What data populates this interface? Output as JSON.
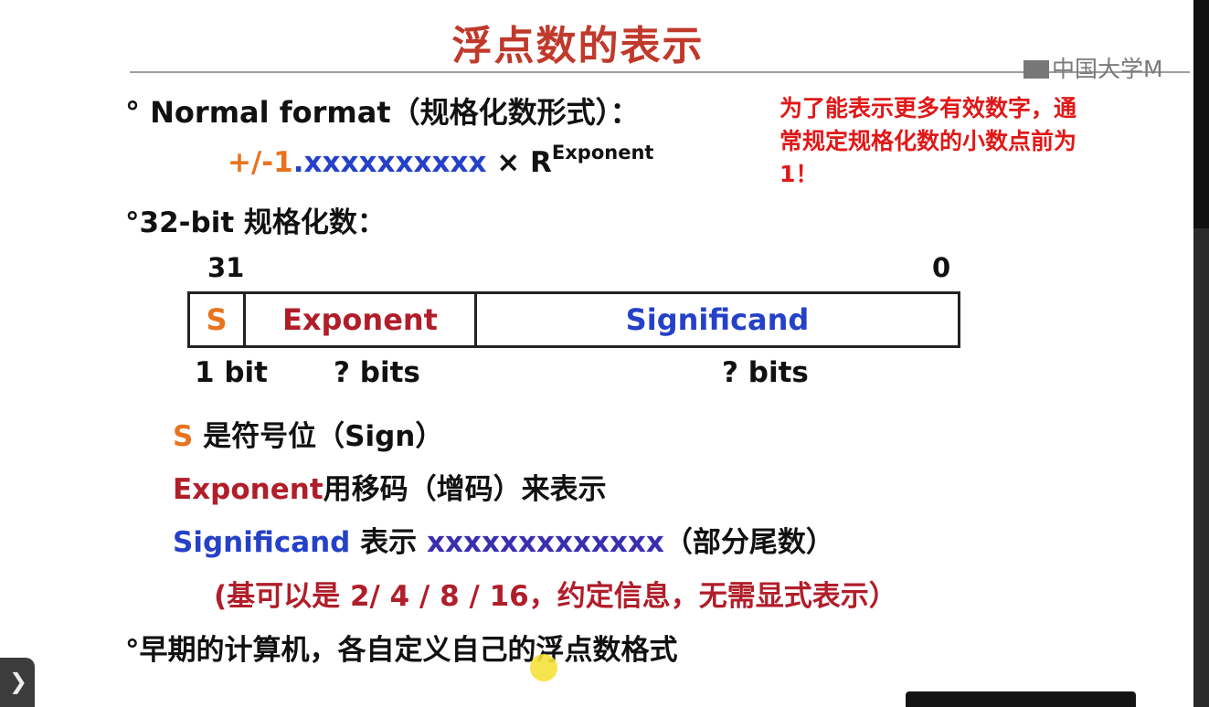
{
  "slide": {
    "title": "浮点数的表示",
    "watermark": "中国大学M",
    "normal_format": {
      "bullet": "°",
      "text": "Normal format（规格化数形式）："
    },
    "note": "为了能表示更多有效数字，通常规定规格化数的小数点前为1！",
    "formula": {
      "sign_part": "+/-1",
      "mantissa_part": ".xxxxxxxxxx",
      "times": " × R",
      "superscript": "Exponent"
    },
    "bit32_heading": "°32-bit 规格化数：",
    "diagram": {
      "high_bit": "31",
      "low_bit": "0",
      "fields": [
        {
          "label": "S",
          "color": "#e8731e"
        },
        {
          "label": "Exponent",
          "color": "#b01e2a"
        },
        {
          "label": "Significand",
          "color": "#2541c8"
        }
      ],
      "widths": [
        "1 bit",
        "? bits",
        "? bits"
      ]
    },
    "descriptions": {
      "s_term": "S",
      "s_rest": " 是符号位（Sign）",
      "exp_term": "Exponent",
      "exp_rest": "用移码（增码）来表示",
      "sig_term": "Significand",
      "sig_mid": " 表示 ",
      "sig_x": "xxxxxxxxxxxxx",
      "sig_rest": "（部分尾数）",
      "base_note": "(基可以是 2/ 4 / 8 / 16，约定信息，无需显式表示）",
      "early": "°早期的计算机，各自定义自己的浮点数格式"
    }
  },
  "colors": {
    "title": "#c0392b",
    "note": "#e01818",
    "orange": "#e8731e",
    "dark_red": "#b01e2a",
    "blue": "#2541c8"
  },
  "player": {
    "prev_icon": "chevron-right-icon",
    "cursor_icon": "mouse-pointer-icon"
  }
}
